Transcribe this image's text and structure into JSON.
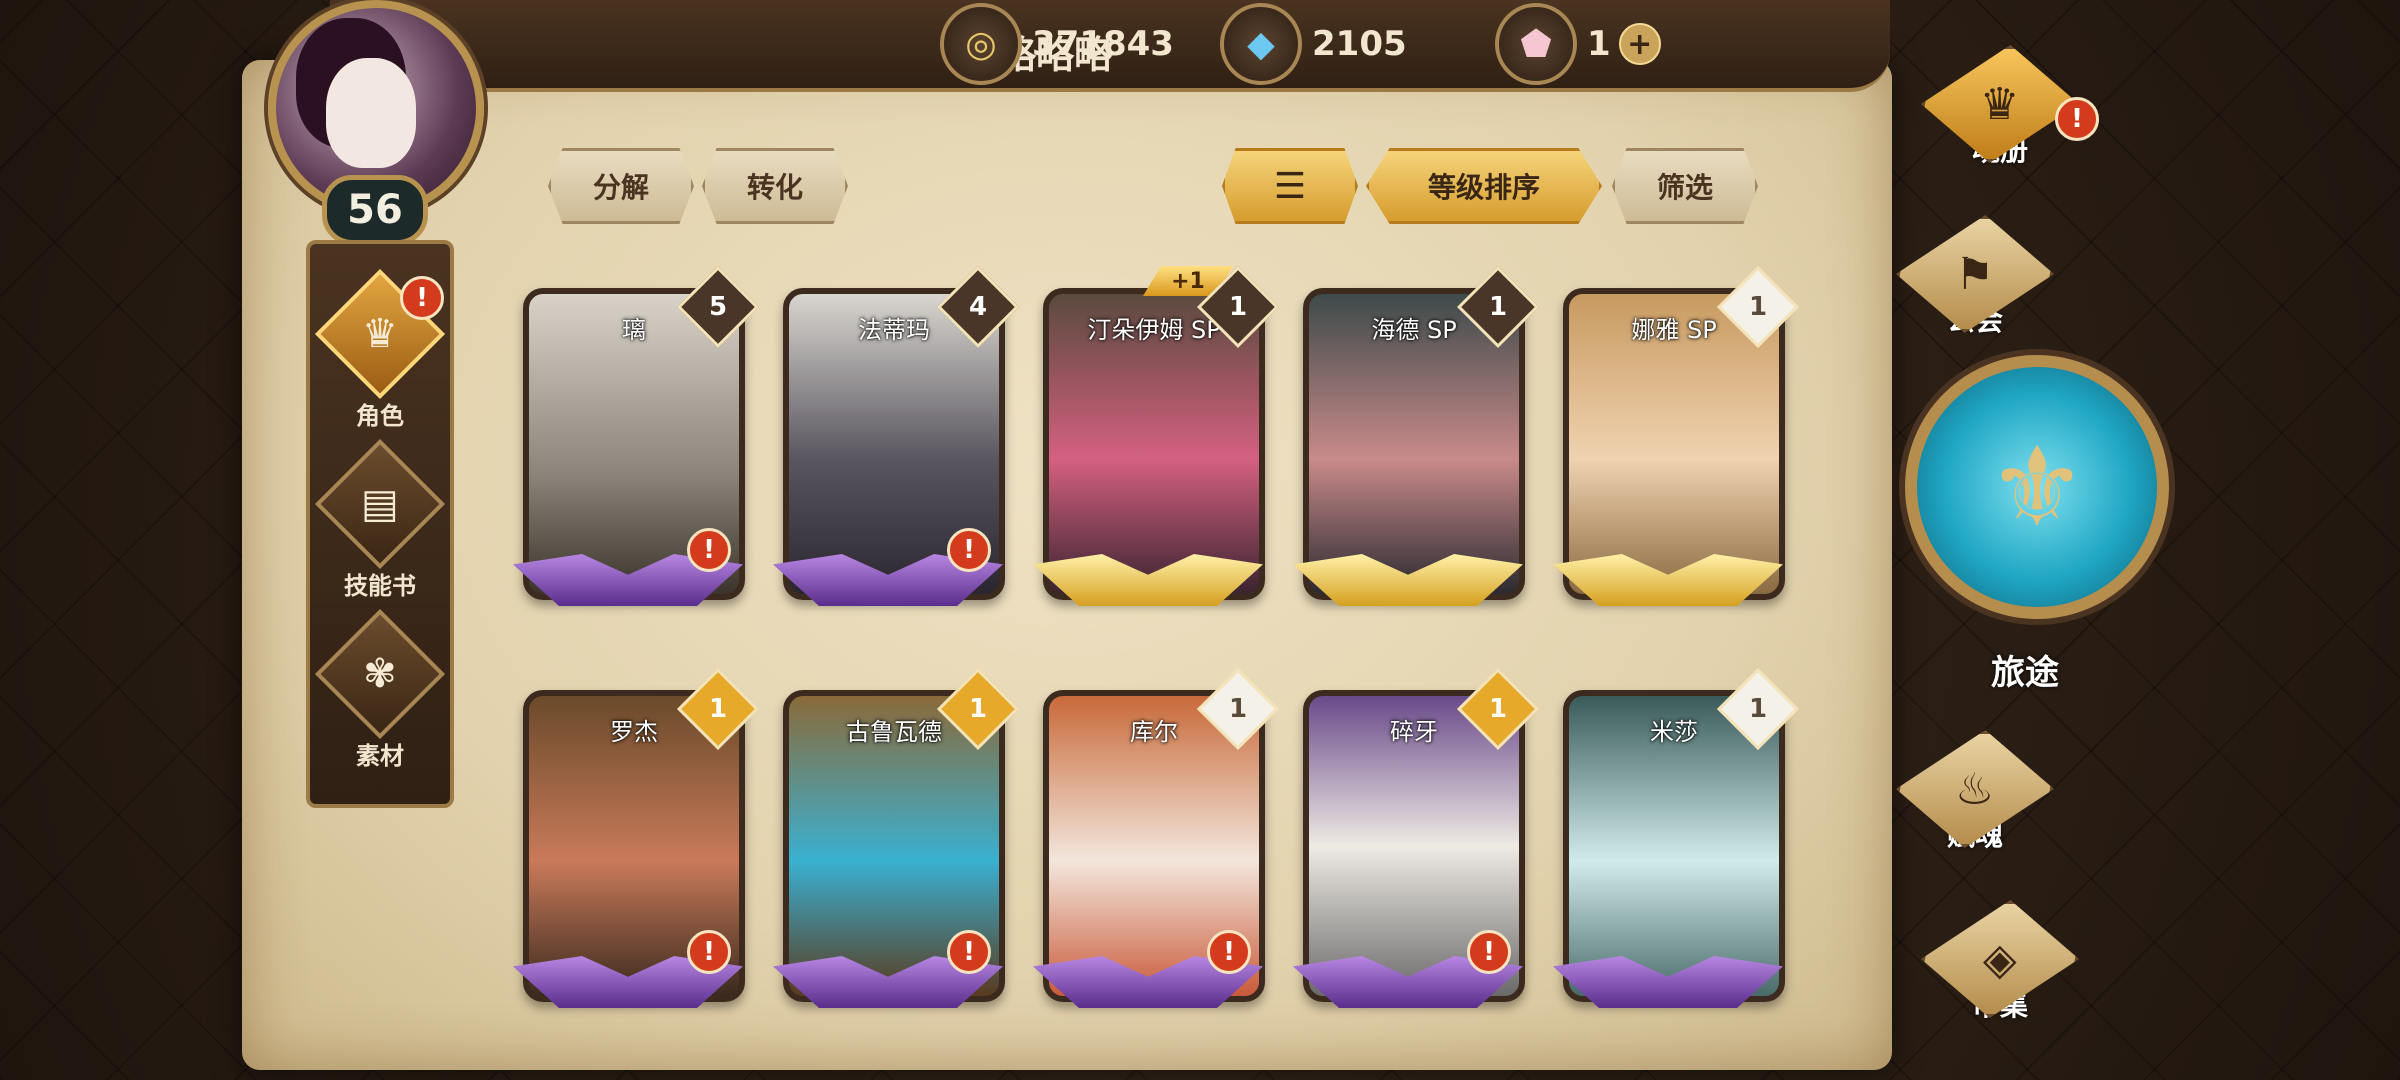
{
  "player": {
    "name": "略略略",
    "level": "56"
  },
  "resources": [
    {
      "icon": "gold-coin-icon",
      "value": "371843"
    },
    {
      "icon": "blue-crystal-icon",
      "value": "2105"
    },
    {
      "icon": "pink-gem-icon",
      "value": "1"
    }
  ],
  "left_nav": [
    {
      "label": "角色",
      "icon": "character-icon",
      "active": true,
      "alert": true
    },
    {
      "label": "技能书",
      "icon": "skillbook-icon",
      "active": false,
      "alert": false
    },
    {
      "label": "素材",
      "icon": "material-icon",
      "active": false,
      "alert": false
    }
  ],
  "toolbar": {
    "decompose": "分解",
    "convert": "转化",
    "sort_level": "等级排序",
    "filter": "筛选"
  },
  "cards": [
    {
      "name": "璃",
      "count": "5",
      "badge": "dark",
      "base": "purple",
      "alert": true
    },
    {
      "name": "法蒂玛",
      "count": "4",
      "badge": "dark",
      "base": "purple",
      "alert": true
    },
    {
      "name": "汀朵伊姆 SP",
      "count": "1",
      "badge": "dark",
      "base": "gold",
      "alert": false,
      "plus": "+1"
    },
    {
      "name": "海德 SP",
      "count": "1",
      "badge": "dark",
      "base": "gold",
      "alert": false
    },
    {
      "name": "娜雅 SP",
      "count": "1",
      "badge": "white",
      "base": "gold",
      "alert": false
    },
    {
      "name": "罗杰",
      "count": "1",
      "badge": "gold",
      "base": "purple",
      "alert": true
    },
    {
      "name": "古鲁瓦德",
      "count": "1",
      "badge": "gold",
      "base": "purple",
      "alert": true
    },
    {
      "name": "库尔",
      "count": "1",
      "badge": "white",
      "base": "purple",
      "alert": true
    },
    {
      "name": "碎牙",
      "count": "1",
      "badge": "gold",
      "base": "purple",
      "alert": true
    },
    {
      "name": "米莎",
      "count": "1",
      "badge": "white",
      "base": "purple",
      "alert": false
    }
  ],
  "right_nav": {
    "soulbook": "魂册",
    "guild": "公会",
    "journey": "旅途",
    "fusoul": "赋魂",
    "market": "市集"
  },
  "alert_symbol": "!",
  "plus_symbol": "+",
  "colors": {
    "accent_gold": "#e6a92a",
    "alert_red": "#d43a1c",
    "journey_blue": "#1fa6c3"
  }
}
